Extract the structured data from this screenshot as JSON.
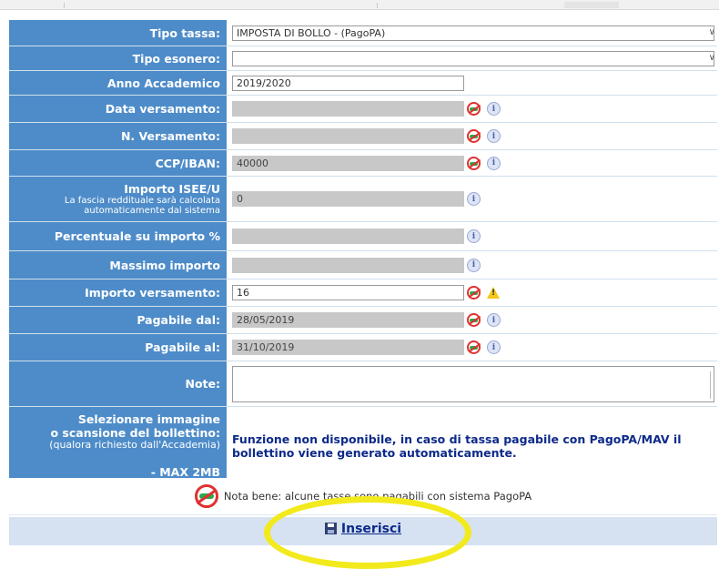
{
  "form": {
    "rows": [
      {
        "label": "Tipo tassa:",
        "value": "IMPOSTA DI BOLLO - (PagoPA)"
      },
      {
        "label": "Tipo esonero:",
        "value": ""
      },
      {
        "label": "Anno Accademico",
        "value": "2019/2020"
      },
      {
        "label": "Data versamento:",
        "value": ""
      },
      {
        "label": "N. Versamento:",
        "value": ""
      },
      {
        "label": "CCP/IBAN:",
        "value": "40000"
      },
      {
        "label": "Importo ISEE/U",
        "sublabel": "La fascia reddituale sarà calcolata automaticamente dal sistema",
        "value": "0"
      },
      {
        "label": "Percentuale su importo %",
        "value": ""
      },
      {
        "label": "Massimo importo",
        "value": ""
      },
      {
        "label": "Importo versamento:",
        "value": "16"
      },
      {
        "label": "Pagabile dal:",
        "value": "28/05/2019"
      },
      {
        "label": "Pagabile al:",
        "value": "31/10/2019"
      },
      {
        "label": "Note:",
        "value": ""
      }
    ],
    "upload": {
      "label_line1": "Selezionare immagine",
      "label_line2": "o scansione del bollettino:",
      "label_line3": "(qualora richiesto dall'Accademia)",
      "label_line4": "- MAX 2MB",
      "message": "Funzione non disponibile, in caso di tassa pagabile con PagoPA/MAV il bollettino viene generato automaticamente."
    }
  },
  "footnote": {
    "text": "Nota bene: alcune tasse sono pagabili con sistema PagoPA"
  },
  "actions": {
    "insert_label": "Inserisci"
  },
  "icons": {
    "nopay": "pagopa-disabled-icon",
    "info": "info-icon",
    "warning": "warning-icon",
    "save": "floppy-disk-icon"
  },
  "colors": {
    "label_bg": "#4e8cc9",
    "label_text": "#ffffff",
    "readonly_field": "#c8c8c8",
    "message_text": "#0d2a8a",
    "button_bar": "#d6e2f2",
    "highlight": "#f2ea1c"
  }
}
